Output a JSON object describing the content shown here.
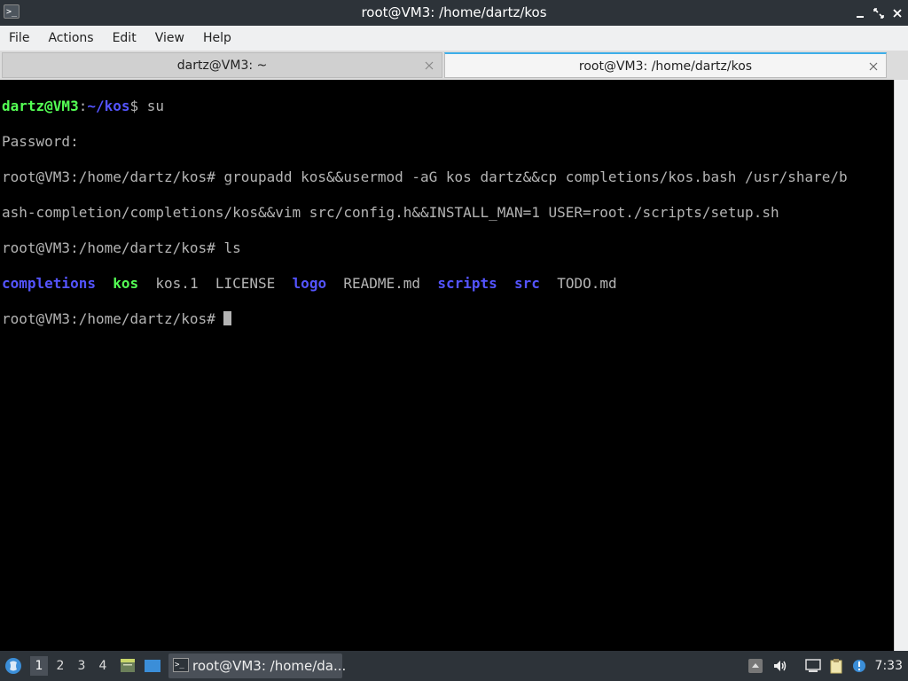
{
  "window": {
    "title": "root@VM3: /home/dartz/kos",
    "icon": "terminal-icon"
  },
  "menu": {
    "file": "File",
    "actions": "Actions",
    "edit": "Edit",
    "view": "View",
    "help": "Help"
  },
  "tabs": [
    {
      "label": "dartz@VM3: ~",
      "active": false
    },
    {
      "label": "root@VM3: /home/dartz/kos",
      "active": true
    }
  ],
  "terminal": {
    "line1": {
      "user_host": "dartz@VM3",
      "sep": ":",
      "path": "~/kos",
      "dollar": "$",
      "cmd": " su"
    },
    "line2": "Password:",
    "line3": "root@VM3:/home/dartz/kos# groupadd kos&&usermod -aG kos dartz&&cp completions/kos.bash /usr/share/b",
    "line4": "ash-completion/completions/kos&&vim src/config.h&&INSTALL_MAN=1 USER=root./scripts/setup.sh",
    "line5": "root@VM3:/home/dartz/kos# ls",
    "ls": {
      "completions": "completions",
      "kos": "kos",
      "kos1": "kos.1",
      "license": "LICENSE",
      "logo": "logo",
      "readme": "README.md",
      "scripts": "scripts",
      "src": "src",
      "todo": "TODO.md"
    },
    "prompt": "root@VM3:/home/dartz/kos# ",
    "colors": {
      "background": "#000000",
      "text": "#b4b4b4",
      "directory": "#5454ff",
      "executable": "#54ff54",
      "user_prompt": "#54ff54"
    }
  },
  "taskbar": {
    "desktops": [
      "1",
      "2",
      "3",
      "4"
    ],
    "active_desktop": "1",
    "task_label": "root@VM3: /home/da...",
    "clock": "7:33"
  }
}
